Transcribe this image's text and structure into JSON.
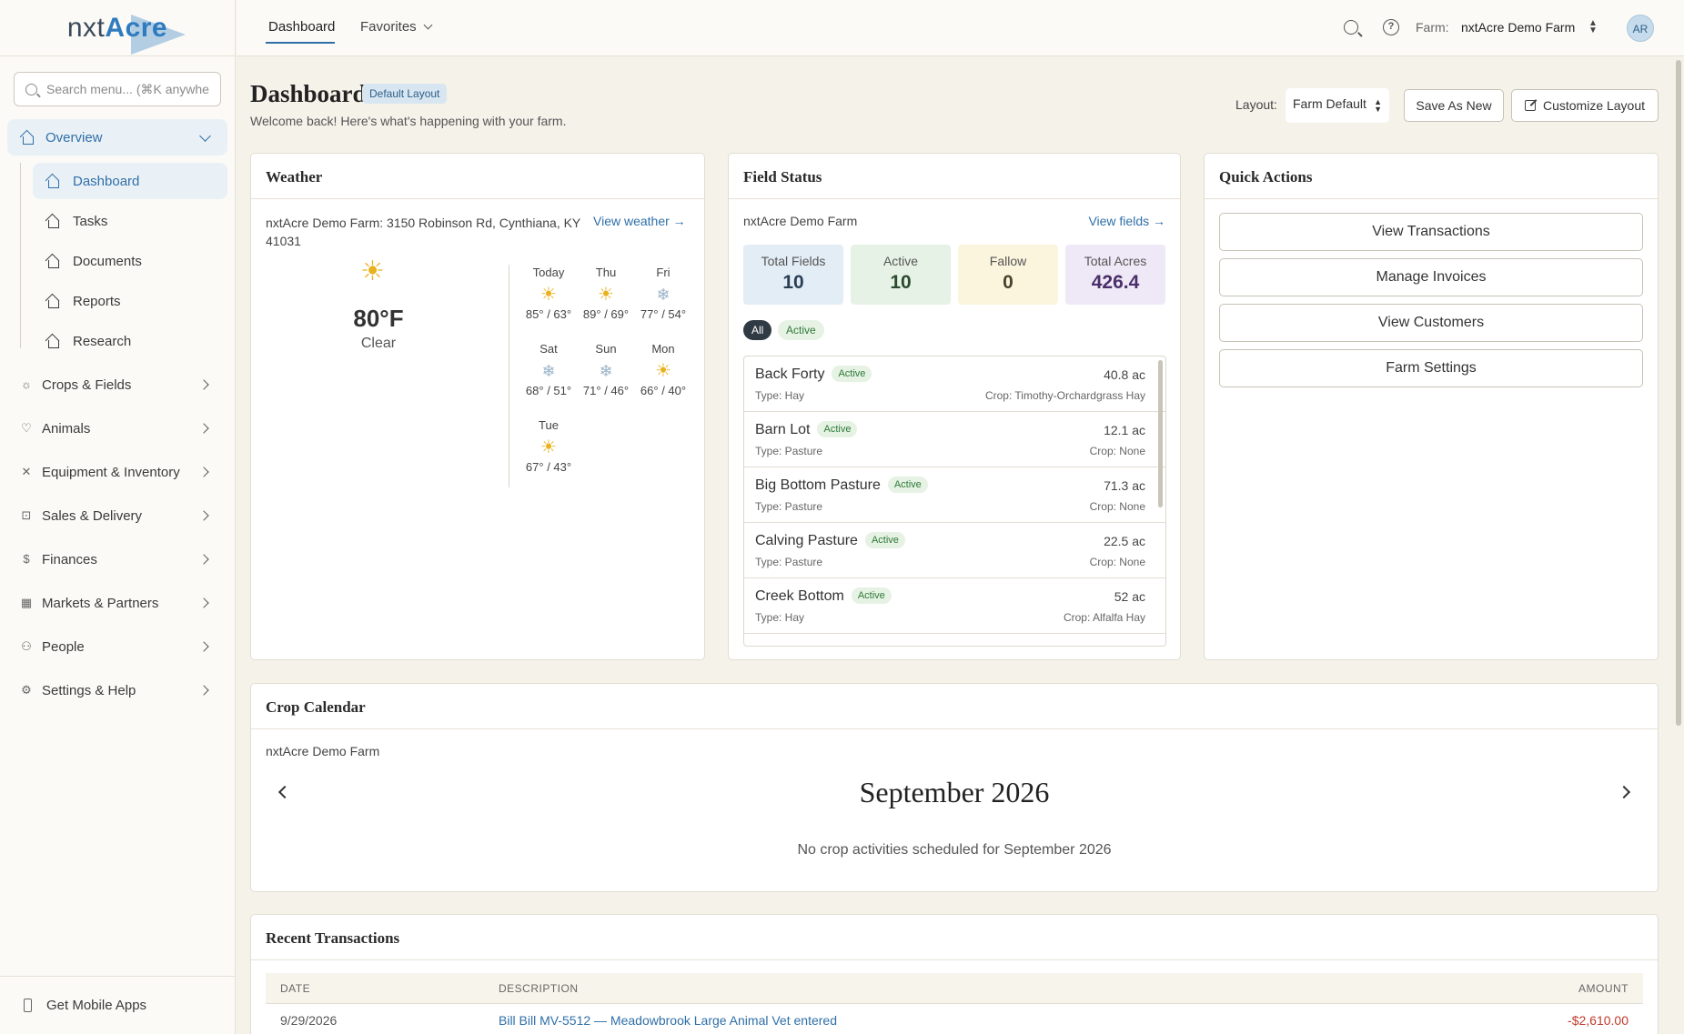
{
  "sidebar": {
    "logo_prefix": "nxt",
    "logo_suffix": "Acre",
    "search_placeholder": "Search menu... (⌘K anywhe",
    "overview": {
      "label": "Overview",
      "icon": "home-icon"
    },
    "sub_items": [
      {
        "label": "Dashboard",
        "icon": "home-icon",
        "active": true
      },
      {
        "label": "Tasks",
        "icon": "home-icon"
      },
      {
        "label": "Documents",
        "icon": "home-icon"
      },
      {
        "label": "Reports",
        "icon": "home-icon"
      },
      {
        "label": "Research",
        "icon": "home-icon"
      }
    ],
    "items": [
      {
        "label": "Crops & Fields",
        "icon": "sun-icon"
      },
      {
        "label": "Animals",
        "icon": "heart-icon"
      },
      {
        "label": "Equipment & Inventory",
        "icon": "tools-icon"
      },
      {
        "label": "Sales & Delivery",
        "icon": "cart-icon"
      },
      {
        "label": "Finances",
        "icon": "dollar-icon"
      },
      {
        "label": "Markets & Partners",
        "icon": "building-icon"
      },
      {
        "label": "People",
        "icon": "people-icon"
      },
      {
        "label": "Settings & Help",
        "icon": "gear-icon"
      }
    ],
    "mobile": "Get Mobile Apps"
  },
  "topbar": {
    "tabs": [
      "Dashboard",
      "Favorites"
    ],
    "farm_label": "Farm:",
    "farm_name": "nxtAcre Demo Farm",
    "avatar": "AR"
  },
  "header": {
    "title": "Dashboard",
    "badge": "Default Layout",
    "subtitle": "Welcome back! Here's what's happening with your farm.",
    "layout_label": "Layout:",
    "layout_value": "Farm Default",
    "save_as_new": "Save As New",
    "customize": "Customize Layout"
  },
  "weather": {
    "title": "Weather",
    "address": "nxtAcre Demo Farm: 3150 Robinson Rd, Cynthiana, KY 41031",
    "link": "View weather →",
    "current_temp": "80°F",
    "current_cond": "Clear",
    "forecast": [
      {
        "day": "Today",
        "icon": "sun",
        "temp": "85° / 63°"
      },
      {
        "day": "Thu",
        "icon": "sun",
        "temp": "89° / 69°"
      },
      {
        "day": "Fri",
        "icon": "snow",
        "temp": "77° / 54°"
      },
      {
        "day": "Sat",
        "icon": "snow",
        "temp": "68° / 51°"
      },
      {
        "day": "Sun",
        "icon": "snow",
        "temp": "71° / 46°"
      },
      {
        "day": "Mon",
        "icon": "sun",
        "temp": "66° / 40°"
      },
      {
        "day": "Tue",
        "icon": "sun",
        "temp": "67° / 43°"
      }
    ]
  },
  "field_status": {
    "title": "Field Status",
    "farm": "nxtAcre Demo Farm",
    "link": "View fields →",
    "stats": [
      {
        "label": "Total Fields",
        "value": "10",
        "bg": "#e3edf5",
        "color": "#2a3f55"
      },
      {
        "label": "Active",
        "value": "10",
        "bg": "#e6f2e6",
        "color": "#2a4a2e"
      },
      {
        "label": "Fallow",
        "value": "0",
        "bg": "#fbf5dd",
        "color": "#4a4230"
      },
      {
        "label": "Total Acres",
        "value": "426.4",
        "bg": "#efe8f6",
        "color": "#4a2f6a"
      }
    ],
    "filters": [
      "All",
      "Active"
    ],
    "fields": [
      {
        "name": "Back Forty",
        "status": "Active",
        "acres": "40.8 ac",
        "type": "Type: Hay",
        "crop": "Crop: Timothy-Orchardgrass Hay"
      },
      {
        "name": "Barn Lot",
        "status": "Active",
        "acres": "12.1 ac",
        "type": "Type: Pasture",
        "crop": "Crop: None"
      },
      {
        "name": "Big Bottom Pasture",
        "status": "Active",
        "acres": "71.3 ac",
        "type": "Type: Pasture",
        "crop": "Crop: None"
      },
      {
        "name": "Calving Pasture",
        "status": "Active",
        "acres": "22.5 ac",
        "type": "Type: Pasture",
        "crop": "Crop: None"
      },
      {
        "name": "Creek Bottom",
        "status": "Active",
        "acres": "52 ac",
        "type": "Type: Hay",
        "crop": "Crop: Alfalfa Hay"
      }
    ]
  },
  "quick_actions": {
    "title": "Quick Actions",
    "buttons": [
      "View Transactions",
      "Manage Invoices",
      "View Customers",
      "Farm Settings"
    ]
  },
  "crop_calendar": {
    "title": "Crop Calendar",
    "farm": "nxtAcre Demo Farm",
    "month": "September 2026",
    "empty": "No crop activities scheduled for September 2026"
  },
  "transactions": {
    "title": "Recent Transactions",
    "columns": [
      "DATE",
      "DESCRIPTION",
      "AMOUNT"
    ],
    "rows": [
      {
        "date": "9/29/2026",
        "description": "Bill Bill MV-5512 — Meadowbrook Large Animal Vet entered",
        "amount": "-$2,610.00"
      }
    ]
  },
  "colors": {
    "accent": "#2f6fa8",
    "negative": "#c0392b",
    "active_green": "#2e7a3a"
  }
}
